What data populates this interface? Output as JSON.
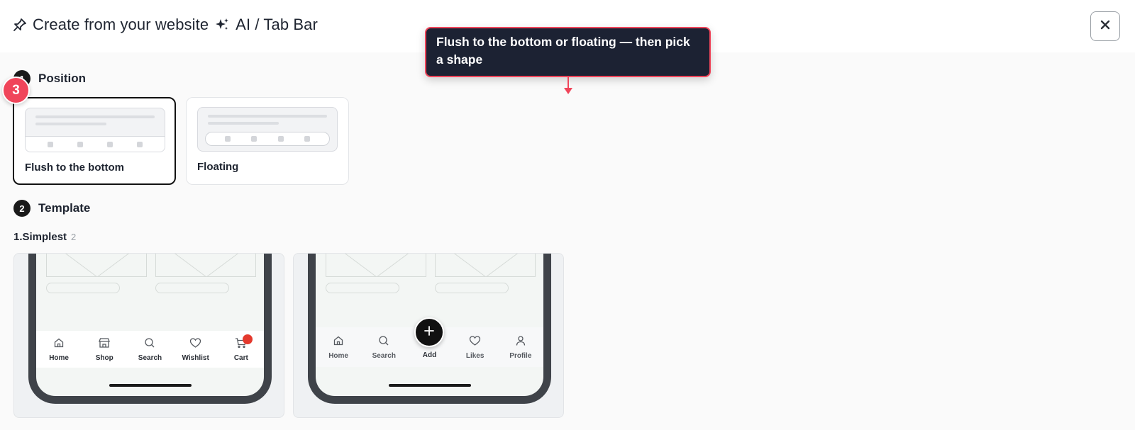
{
  "header": {
    "title_prefix": "Create from your website",
    "title_suffix": "AI / Tab Bar"
  },
  "steps": {
    "position": {
      "number": "1",
      "label": "Position"
    },
    "template": {
      "number": "2",
      "label": "Template"
    }
  },
  "step_badge": "3",
  "position_options": [
    {
      "label": "Flush to the bottom",
      "selected": true
    },
    {
      "label": "Floating",
      "selected": false
    }
  ],
  "template_group": {
    "name": "1.Simplest",
    "count": "2"
  },
  "templates": [
    {
      "tabs": [
        {
          "label": "Home",
          "icon": "home-icon"
        },
        {
          "label": "Shop",
          "icon": "shop-icon"
        },
        {
          "label": "Search",
          "icon": "search-icon"
        },
        {
          "label": "Wishlist",
          "icon": "heart-icon"
        },
        {
          "label": "Cart",
          "icon": "cart-icon"
        }
      ]
    },
    {
      "tabs": [
        {
          "label": "Home",
          "icon": "home-icon"
        },
        {
          "label": "Search",
          "icon": "search-icon"
        },
        {
          "label": "Add",
          "icon": "plus-icon"
        },
        {
          "label": "Likes",
          "icon": "heart-icon"
        },
        {
          "label": "Profile",
          "icon": "person-icon"
        }
      ]
    }
  ],
  "tooltip": {
    "text": "Flush to the bottom or floating — then pick a shape"
  },
  "colors": {
    "accent": "#f0455a",
    "tooltip_bg": "#1c2233",
    "cart_dot": "#e4392d"
  }
}
